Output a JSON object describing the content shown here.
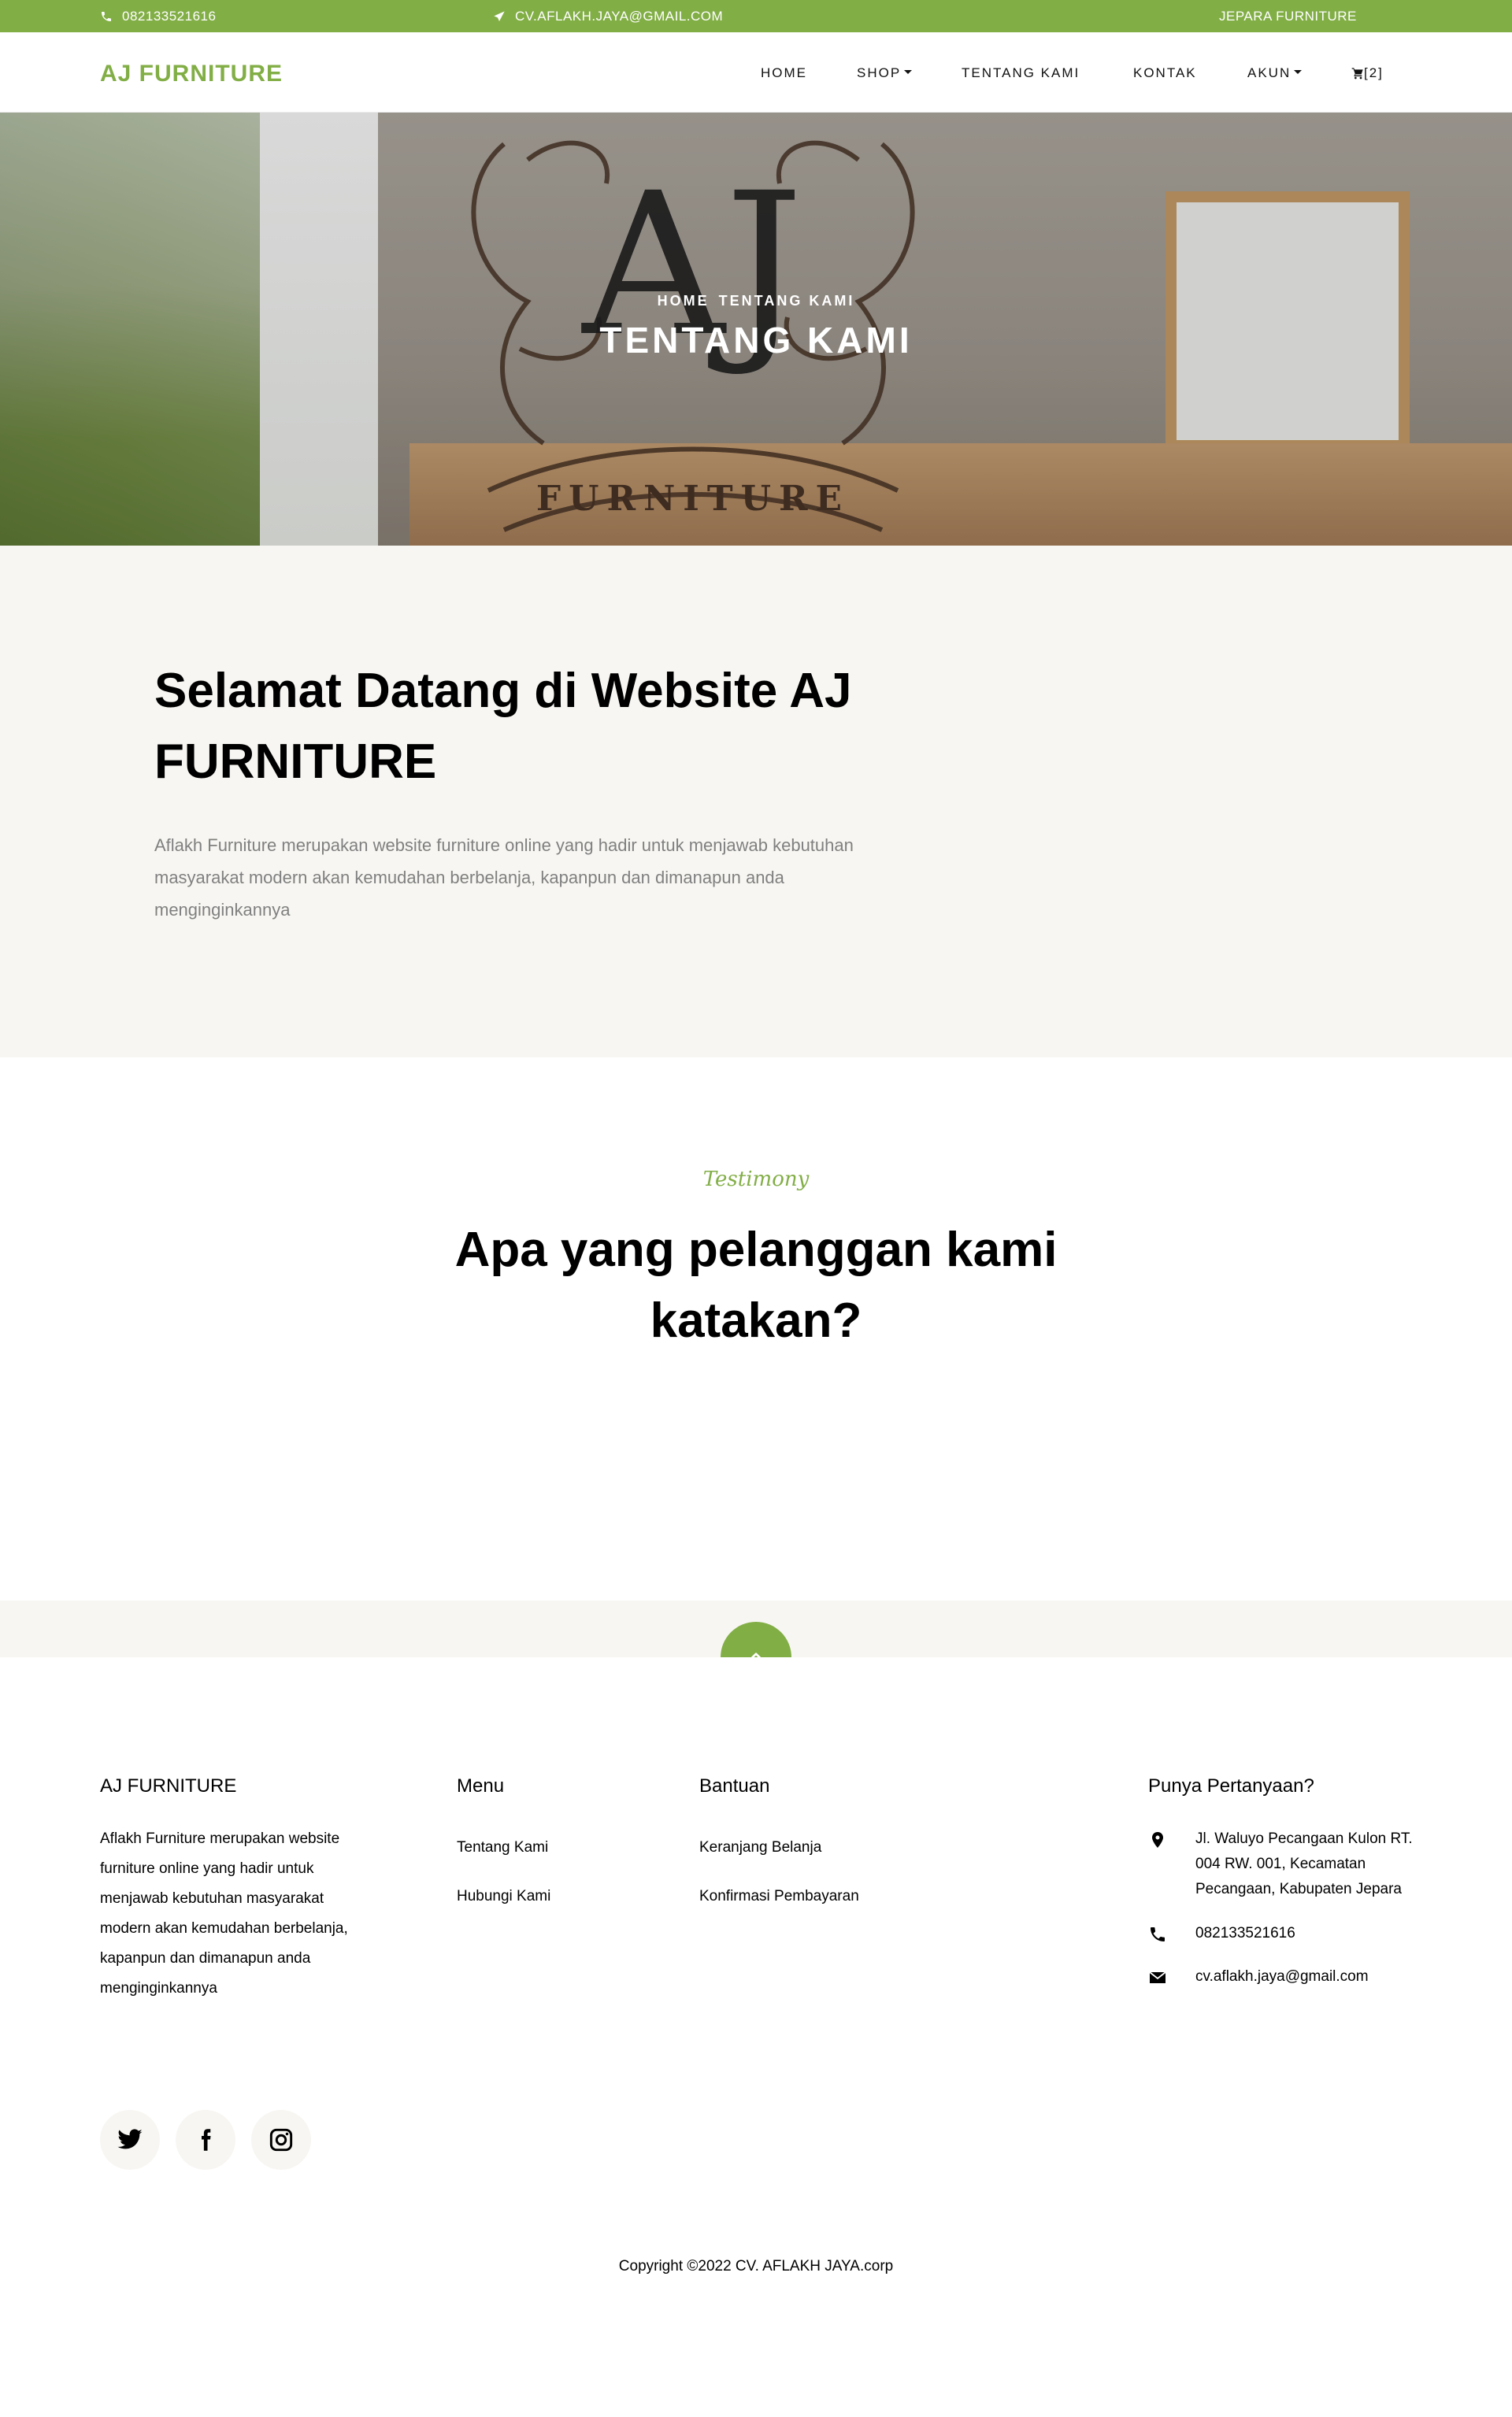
{
  "colors": {
    "accent": "#82ae46",
    "light_bg": "#f7f6f2",
    "muted_text": "#808080"
  },
  "topbar": {
    "phone": "082133521616",
    "email": "CV.AFLAKH.JAYA@GMAIL.COM",
    "tagline": "JEPARA FURNITURE",
    "phone_icon": "phone-icon",
    "email_icon": "paper-plane-icon"
  },
  "navbar": {
    "brand": "AJ FURNITURE",
    "items": [
      {
        "label": "HOME"
      },
      {
        "label": "SHOP",
        "dropdown": true
      },
      {
        "label": "TENTANG KAMI"
      },
      {
        "label": "KONTAK"
      },
      {
        "label": "AKUN",
        "dropdown": true
      }
    ],
    "cart": {
      "icon": "cart-icon",
      "count": "[2]"
    }
  },
  "hero": {
    "breadcrumb": [
      "HOME",
      "TENTANG KAMI"
    ],
    "title": "TENTANG KAMI",
    "emblem_text": "AJ",
    "emblem_banner": "FURNITURE"
  },
  "about": {
    "heading": "Selamat Datang di Website AJ FURNITURE",
    "text": "Aflakh Furniture merupakan website furniture online yang hadir untuk menjawab kebutuhan masyarakat modern akan kemudahan berbelanja, kapanpun dan dimanapun anda menginginkannya"
  },
  "testimony": {
    "subheading": "Testimony",
    "heading": "Apa yang pelanggan kami katakan?"
  },
  "footer": {
    "brand_title": "AJ FURNITURE",
    "brand_text": "Aflakh Furniture merupakan website furniture online yang hadir untuk menjawab kebutuhan masyarakat modern akan kemudahan berbelanja, kapanpun dan dimanapun anda menginginkannya",
    "menu_title": "Menu",
    "menu_links": [
      "Tentang Kami",
      "Hubungi Kami"
    ],
    "help_title": "Bantuan",
    "help_links": [
      "Keranjang Belanja",
      "Konfirmasi Pembayaran"
    ],
    "contact_title": "Punya Pertanyaan?",
    "address": "Jl. Waluyo Pecangaan Kulon RT. 004 RW. 001, Kecamatan Pecangaan, Kabupaten Jepara",
    "phone": "082133521616",
    "email": "cv.aflakh.jaya@gmail.com",
    "social": [
      "twitter-icon",
      "facebook-icon",
      "instagram-icon"
    ],
    "copyright": "Copyright ©2022 CV. AFLAKH JAYA.corp"
  }
}
